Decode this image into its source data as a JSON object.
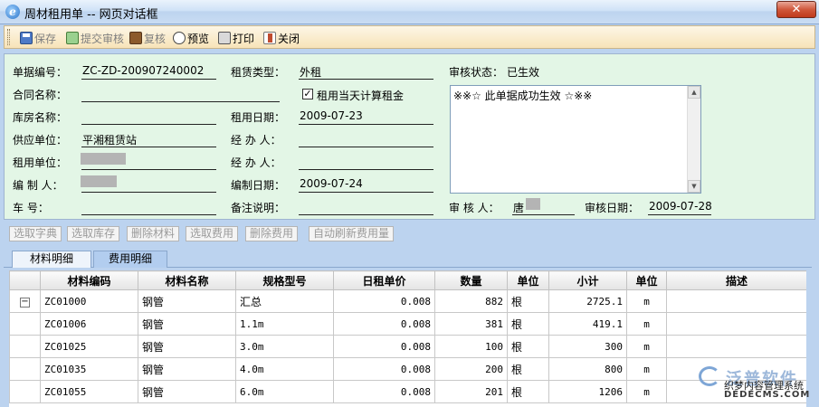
{
  "window": {
    "title": "周材租用单 -- 网页对话框",
    "close_label": "✕"
  },
  "toolbar": {
    "buttons": [
      {
        "label": "保存",
        "icon": "save-icon",
        "disabled": true
      },
      {
        "label": "提交审核",
        "icon": "submit-review-icon",
        "disabled": true
      },
      {
        "label": "复核",
        "icon": "recheck-icon",
        "disabled": true
      },
      {
        "label": "预览",
        "icon": "preview-icon",
        "disabled": false
      },
      {
        "label": "打印",
        "icon": "print-icon",
        "disabled": false
      },
      {
        "label": "关闭",
        "icon": "close-icon",
        "disabled": false
      }
    ]
  },
  "form": {
    "doc_no_label": "单据编号：",
    "doc_no": "ZC-ZD-200907240002",
    "contract_label": "合同名称：",
    "contract": "",
    "warehouse_label": "库房名称：",
    "warehouse": "",
    "supplier_label": "供应单位：",
    "supplier": "平湘租赁站",
    "renter_label": "租用单位：",
    "creator_label": "编  制  人：",
    "vehicle_label": "车      号：",
    "vehicle": "",
    "lease_type_label": "租赁类型：",
    "lease_type": "外租",
    "same_day_label": "租用当天计算租金",
    "same_day_checked": "✓",
    "rent_date_label": "租用日期：",
    "rent_date": "2009-07-23",
    "handler1_label": "经  办  人：",
    "handler1": "",
    "handler2_label": "经  办  人：",
    "handler2": "",
    "create_date_label": "编制日期：",
    "create_date": "2009-07-24",
    "remark_label": "备注说明：",
    "remark": "",
    "audit_status_label": "审核状态：",
    "audit_status": "已生效",
    "audit_text": "※※☆ 此单据成功生效 ☆※※",
    "auditor_label": "审  核  人：",
    "auditor": "唐",
    "audit_date_label": "审核日期：",
    "audit_date": "2009-07-28"
  },
  "actions": [
    "选取字典",
    "选取库存",
    "删除材料",
    "选取费用",
    "删除费用",
    "自动刷新费用量"
  ],
  "tabs": [
    {
      "label": "材料明细",
      "active": true
    },
    {
      "label": "费用明细",
      "active": false
    }
  ],
  "grid": {
    "columns": [
      "",
      "材料编码",
      "材料名称",
      "规格型号",
      "日租单价",
      "数量",
      "单位",
      "小计",
      "单位",
      "描述"
    ],
    "rows": [
      {
        "expander": "−",
        "code": "ZC01000",
        "name": "钢管",
        "spec": "汇总",
        "price": "0.008",
        "qty": "882",
        "unit": "根",
        "subtotal": "2725.1",
        "unit2": "m",
        "desc": ""
      },
      {
        "expander": "",
        "code": "ZC01006",
        "name": "钢管",
        "spec": "1.1m",
        "price": "0.008",
        "qty": "381",
        "unit": "根",
        "subtotal": "419.1",
        "unit2": "m",
        "desc": ""
      },
      {
        "expander": "",
        "code": "ZC01025",
        "name": "钢管",
        "spec": "3.0m",
        "price": "0.008",
        "qty": "100",
        "unit": "根",
        "subtotal": "300",
        "unit2": "m",
        "desc": ""
      },
      {
        "expander": "",
        "code": "ZC01035",
        "name": "钢管",
        "spec": "4.0m",
        "price": "0.008",
        "qty": "200",
        "unit": "根",
        "subtotal": "800",
        "unit2": "m",
        "desc": ""
      },
      {
        "expander": "",
        "code": "ZC01055",
        "name": "钢管",
        "spec": "6.0m",
        "price": "0.008",
        "qty": "201",
        "unit": "根",
        "subtotal": "1206",
        "unit2": "m",
        "desc": ""
      }
    ]
  },
  "watermark": {
    "brand": "泛普软件",
    "sub": "织梦内容管理系统",
    "domain": "DEDECMS.COM"
  }
}
